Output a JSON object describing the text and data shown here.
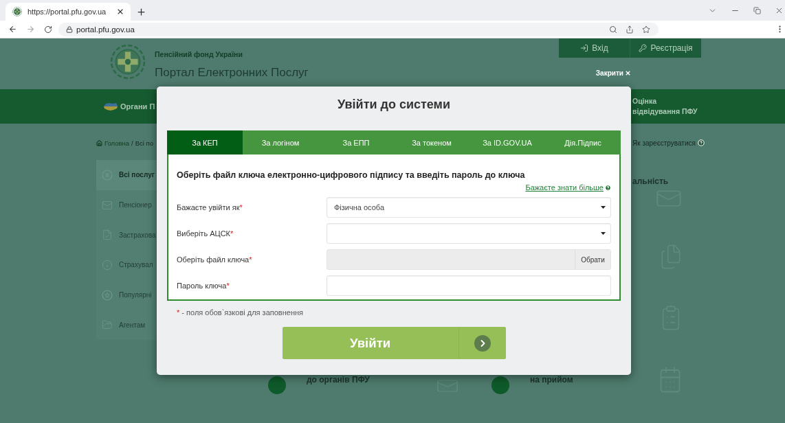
{
  "browser": {
    "tab_title": "https://portal.pfu.gov.ua",
    "address": "portal.pfu.gov.ua"
  },
  "header": {
    "org_name": "Пенсійний фонд України",
    "portal_name": "Портал Електронних Послуг",
    "auth_links": [
      {
        "label": "Вхід",
        "kind": "login"
      },
      {
        "label": "Реєстрація",
        "kind": "register"
      }
    ]
  },
  "nav": {
    "left": "Органи П",
    "right": "Оцінка відвідування ПФУ"
  },
  "breadcrumb": {
    "items": [
      "Головна",
      "Всі по"
    ],
    "separator": "/"
  },
  "register_help": "Як зареєструватися",
  "sidebar": [
    {
      "label": "Всі послуг",
      "kind": "all",
      "selected": true
    },
    {
      "label": "Пенсіонер",
      "kind": "mail",
      "selected": false
    },
    {
      "label": "Застрахова",
      "kind": "document",
      "selected": false
    },
    {
      "label": "Страхувал",
      "kind": "info",
      "selected": false
    },
    {
      "label": "Популярні",
      "kind": "star",
      "selected": false
    },
    {
      "label": "Агентам",
      "kind": "folder",
      "selected": false
    }
  ],
  "services": {
    "right_column": [
      {
        "title": "альність",
        "kind": "mail"
      },
      {
        "kind": "document"
      },
      {
        "kind": "list"
      }
    ],
    "bottom_row": [
      {
        "title": "до органів ПФУ",
        "kind": "mail"
      },
      {
        "title": "на прийом",
        "kind": "calendar"
      }
    ]
  },
  "modal": {
    "close_label": "Закрити",
    "title": "Увійти до системи",
    "tabs": [
      {
        "label": "За КЕП",
        "selected": true
      },
      {
        "label": "За логіном",
        "selected": false
      },
      {
        "label": "За ЕПП",
        "selected": false
      },
      {
        "label": "За токеном",
        "selected": false
      },
      {
        "label": "За ID.GOV.UA",
        "selected": false
      },
      {
        "label": "Дія.Підпис",
        "selected": false
      }
    ],
    "heading": "Оберіть файл ключа електронно-цифрового підпису та введіть пароль до ключа",
    "more_link": "Бажаєте знати більше",
    "fields": [
      {
        "label": "Бажаєте увійти як",
        "mark": "*",
        "kind": "select",
        "value": "Фізична особа",
        "disabled": false
      },
      {
        "label": "Виберіть АЦСК",
        "mark": "*",
        "kind": "select",
        "disabled": false
      },
      {
        "label": "Оберіть файл ключа",
        "mark": "*",
        "kind": "file",
        "button": "Обрати",
        "disabled": true
      },
      {
        "label": "Пароль ключа",
        "mark": "*",
        "kind": "password",
        "disabled": false
      }
    ],
    "required_note": {
      "mark": "*",
      "text": "- поля обов`язкові для заповнення"
    },
    "submit": "Увійти"
  }
}
